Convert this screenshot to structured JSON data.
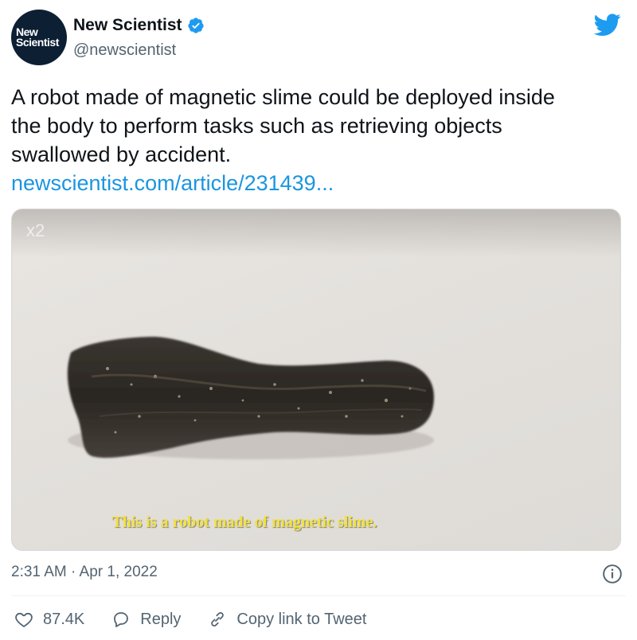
{
  "author": {
    "avatar_line1": "New",
    "avatar_line2": "Scientist",
    "name": "New Scientist",
    "handle": "@newscientist"
  },
  "tweet": {
    "text_lines": [
      "A robot made of magnetic slime could be deployed inside",
      "the body to perform tasks such as retrieving objects",
      "swallowed by accident."
    ],
    "link": "newscientist.com/article/231439..."
  },
  "media": {
    "speed_label": "x2",
    "caption": "This is a robot made of magnetic slime."
  },
  "timestamp": "2:31 AM · Apr 1, 2022",
  "actions": {
    "like_count": "87.4K",
    "reply_label": "Reply",
    "copy_link_label": "Copy link to Tweet"
  },
  "colors": {
    "link": "#1b95e0",
    "twitter_blue": "#1d9bf0",
    "caption_yellow": "#f3e23a"
  }
}
